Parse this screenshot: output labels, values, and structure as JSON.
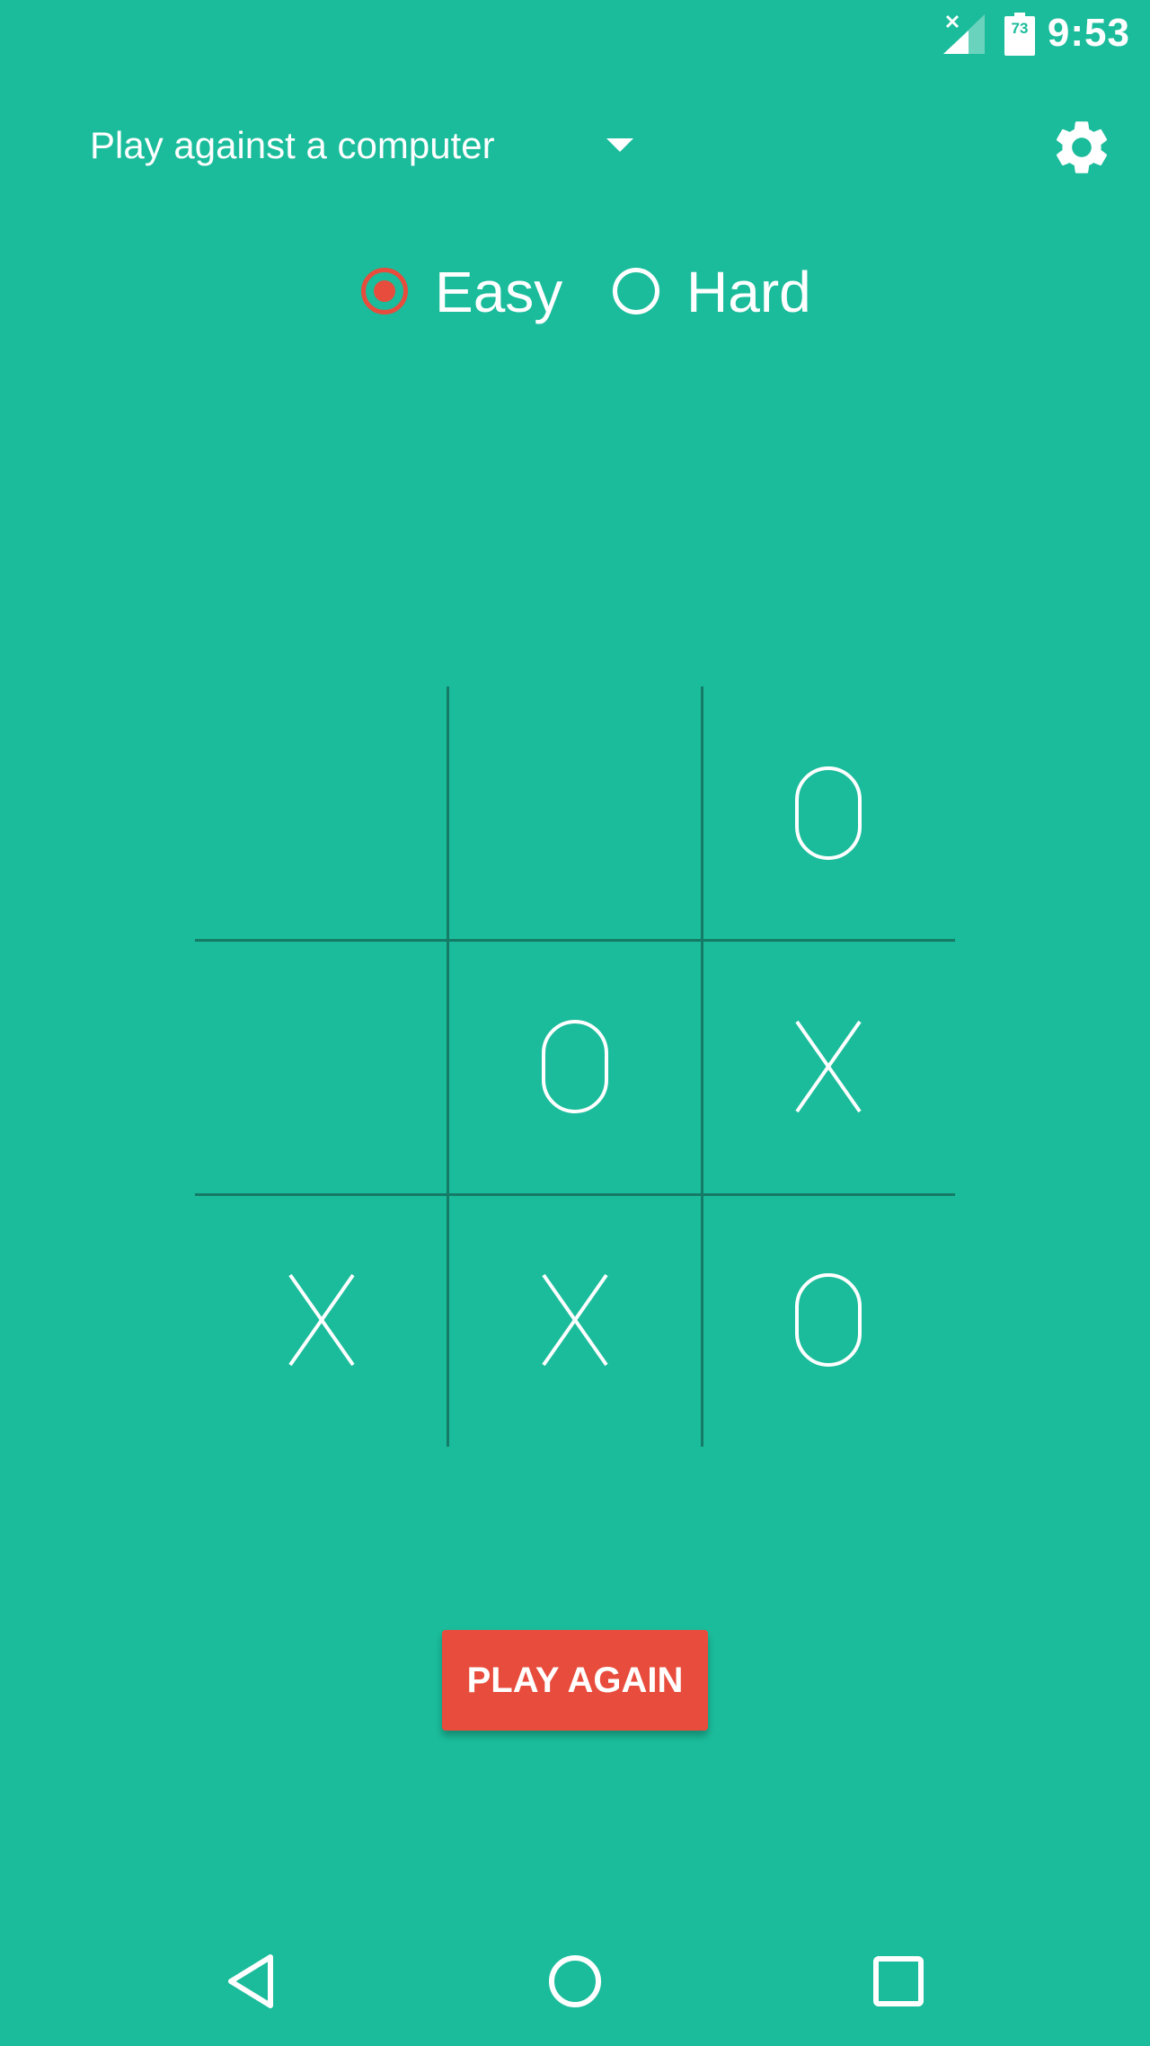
{
  "status_bar": {
    "time": "9:53",
    "battery_level": "73",
    "signal_icon": "signal-no-data-icon",
    "battery_icon": "battery-icon"
  },
  "header": {
    "mode_label": "Play against a computer",
    "dropdown_icon": "chevron-down-icon",
    "settings_icon": "gear-icon"
  },
  "difficulty": {
    "options": [
      {
        "label": "Easy",
        "checked": true
      },
      {
        "label": "Hard",
        "checked": false
      }
    ]
  },
  "board": {
    "cells": [
      "",
      "",
      "O",
      "",
      "O",
      "X",
      "X",
      "X",
      "O"
    ]
  },
  "play_again": {
    "label": "PLAY AGAIN"
  },
  "nav_bar": {
    "back_icon": "back-icon",
    "home_icon": "home-icon",
    "recents_icon": "recents-icon"
  },
  "colors": {
    "background": "#1bbc9b",
    "accent": "#e74c3c",
    "grid": "#157a66",
    "mark": "#ffffff"
  }
}
